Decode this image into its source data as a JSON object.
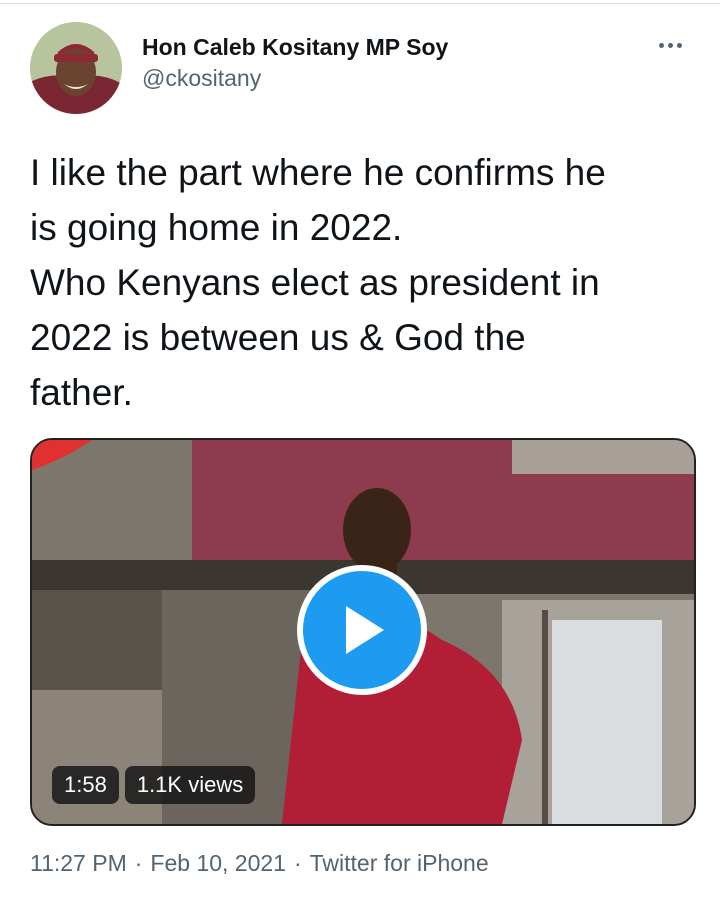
{
  "author": {
    "display_name": "Hon Caleb Kositany MP Soy",
    "handle": "@ckositany"
  },
  "tweet": {
    "text": "I like the part where he confirms he\nis going home in 2022.\nWho Kenyans elect as president in\n2022 is between us & God the\nfather."
  },
  "media": {
    "duration": "1:58",
    "views": "1.1K views"
  },
  "meta": {
    "time": "11:27 PM",
    "separator": "·",
    "date": "Feb 10, 2021",
    "source": "Twitter for iPhone"
  },
  "colors": {
    "accent": "#1d9bf0",
    "text": "#0f1419",
    "secondary": "#536471"
  },
  "icons": {
    "more": "more-horizontal-icon",
    "play": "play-icon",
    "channel_logo": "channel-logo-icon"
  }
}
